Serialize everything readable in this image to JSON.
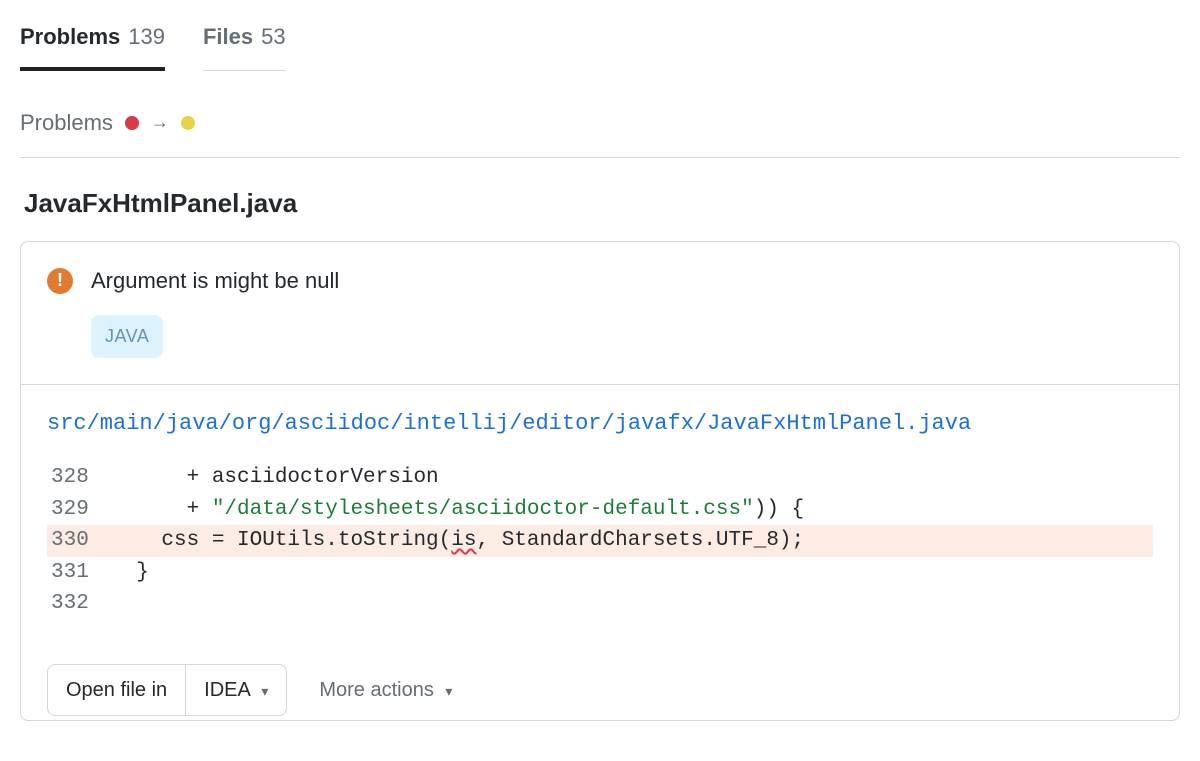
{
  "tabs": {
    "problems": {
      "label": "Problems",
      "count": "139"
    },
    "files": {
      "label": "Files",
      "count": "53"
    }
  },
  "section": {
    "title": "Problems"
  },
  "file": {
    "heading": "JavaFxHtmlPanel.java"
  },
  "issue": {
    "message": "Argument is might be null",
    "tag": "JAVA"
  },
  "code": {
    "path": "src/main/java/org/asciidoc/intellij/editor/javafx/JavaFxHtmlPanel.java",
    "lines": {
      "l328": {
        "num": "328",
        "text_a": "      + asciidoctorVersion"
      },
      "l329": {
        "num": "329",
        "text_a": "      + ",
        "str": "\"/data/stylesheets/asciidoctor-default.css\"",
        "text_b": ")) {"
      },
      "l330": {
        "num": "330",
        "text_a": "    css = IOUtils.toString(",
        "err": "is",
        "text_b": ", StandardCharsets.UTF_8);"
      },
      "l331": {
        "num": "331",
        "text_a": "  }"
      },
      "l332": {
        "num": "332",
        "text_a": ""
      }
    }
  },
  "actions": {
    "open_label": "Open file in",
    "open_target": "IDEA",
    "more_label": "More actions"
  }
}
